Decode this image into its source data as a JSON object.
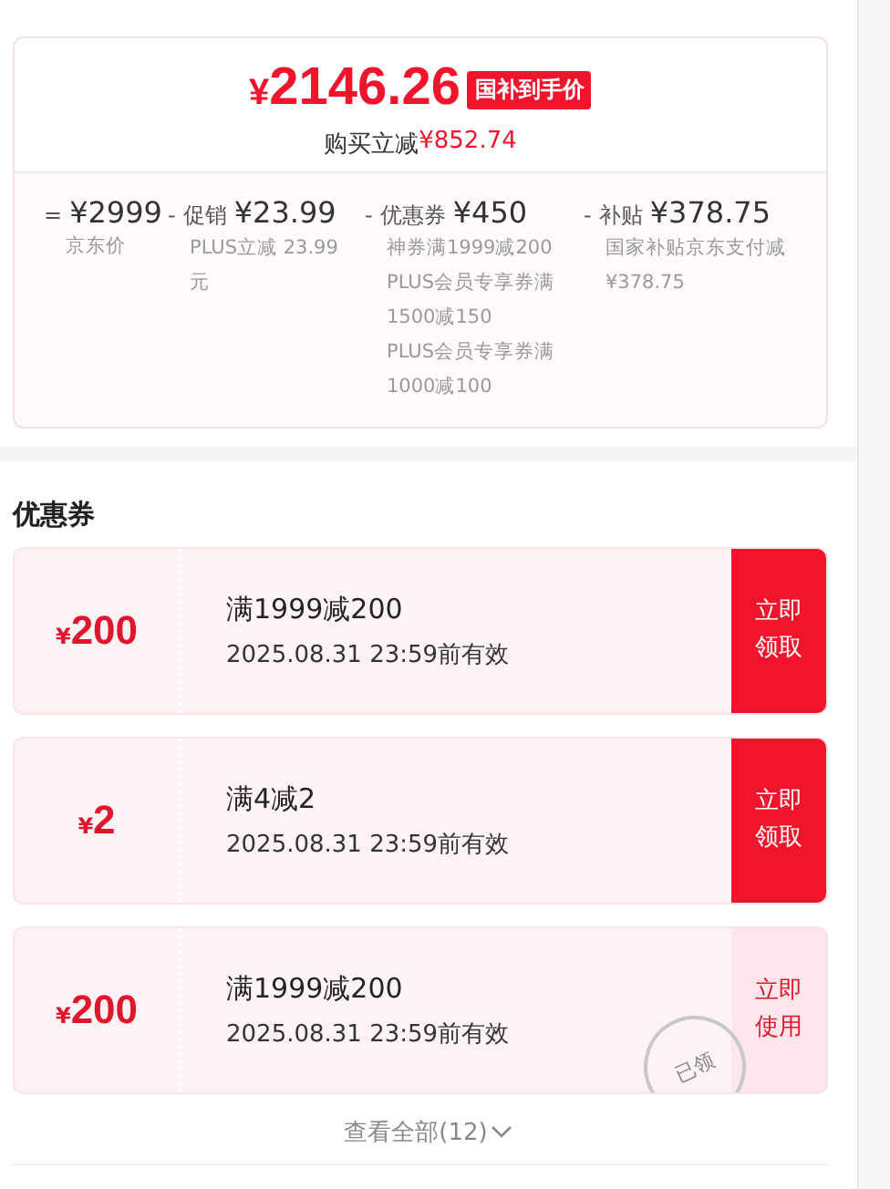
{
  "price_card": {
    "currency": "¥",
    "final_price": "2146.26",
    "price_tag": "国补到手价",
    "savings_label": "购买立减",
    "savings_amount": "¥852.74",
    "breakdown": [
      {
        "op": "=",
        "amount": "¥2999",
        "details": [
          "京东价"
        ]
      },
      {
        "op": "-",
        "label": "促销",
        "amount": "¥23.99",
        "details": [
          "PLUS立减 23.99元"
        ]
      },
      {
        "op": "-",
        "label": "优惠券",
        "amount": "¥450",
        "details": [
          "神券满1999减200",
          "PLUS会员专享券满1500减150",
          "PLUS会员专享券满1000减100"
        ]
      },
      {
        "op": "-",
        "label": "补贴",
        "amount": "¥378.75",
        "details": [
          "国家补贴京东支付减¥378.75"
        ]
      }
    ]
  },
  "coupons": {
    "title": "优惠券",
    "items": [
      {
        "currency": "¥",
        "amount": "200",
        "condition": "满1999减200",
        "validity": "2025.08.31 23:59前有效",
        "action": "立即领取",
        "claimed": false
      },
      {
        "currency": "¥",
        "amount": "2",
        "condition": "满4减2",
        "validity": "2025.08.31 23:59前有效",
        "action": "立即领取",
        "claimed": false
      },
      {
        "currency": "¥",
        "amount": "200",
        "condition": "满1999减200",
        "validity": "2025.08.31 23:59前有效",
        "action": "立即使用",
        "claimed": true,
        "stamp": "已领"
      }
    ],
    "view_all": "查看全部(12)"
  }
}
